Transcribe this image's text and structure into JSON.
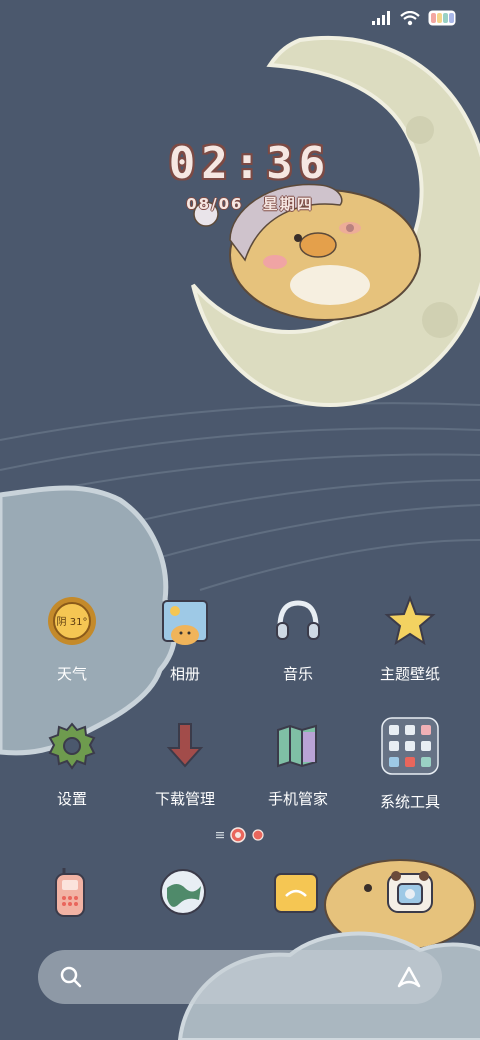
{
  "clock": {
    "time": "02:36",
    "date": "08/06",
    "weekday": "星期四"
  },
  "status": {
    "battery_colors": [
      "#f3a7a1",
      "#f5d58a",
      "#9ad1c4",
      "#a9b7e8"
    ]
  },
  "apps": [
    {
      "label": "天气",
      "icon": "weather-icon",
      "badge": "阴 31°"
    },
    {
      "label": "相册",
      "icon": "gallery-icon"
    },
    {
      "label": "音乐",
      "icon": "headphones-icon"
    },
    {
      "label": "主题壁纸",
      "icon": "star-icon"
    },
    {
      "label": "设置",
      "icon": "gear-icon"
    },
    {
      "label": "下载管理",
      "icon": "download-arrow-icon"
    },
    {
      "label": "手机管家",
      "icon": "map-icon"
    },
    {
      "label": "系统工具",
      "icon": "folder-icon"
    }
  ],
  "dock": [
    "phone-icon",
    "browser-globe-icon",
    "messages-icon",
    "camera-icon"
  ],
  "pager": {
    "pages": 3,
    "current": 2
  },
  "search": {
    "icons": [
      "search-icon",
      "assistant-icon"
    ]
  },
  "colors": {
    "background": "#4b586d",
    "moon": "#dcdcc0",
    "cloud": "#9aaab5",
    "chick": "#e6c27c",
    "accent": "#e9665c"
  }
}
